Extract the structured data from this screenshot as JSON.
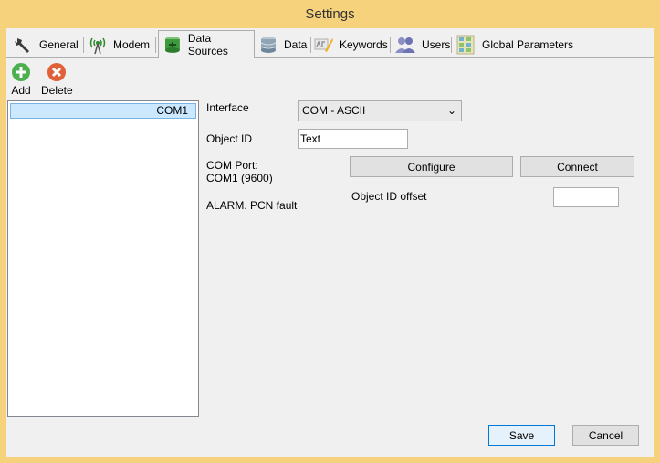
{
  "window": {
    "title": "Settings"
  },
  "tabs": [
    {
      "label": "General",
      "icon": "wrench-icon"
    },
    {
      "label": "Modem",
      "icon": "antenna-icon"
    },
    {
      "label": "Data Sources",
      "icon": "database-plug-icon"
    },
    {
      "label": "Data",
      "icon": "database-icon"
    },
    {
      "label": "Keywords",
      "icon": "keywords-icon"
    },
    {
      "label": "Users",
      "icon": "users-icon"
    },
    {
      "label": "Global Parameters",
      "icon": "grid-icon"
    }
  ],
  "active_tab": "Data Sources",
  "toolbar": {
    "add_label": "Add",
    "delete_label": "Delete"
  },
  "sources_list": {
    "items": [
      "COM1"
    ],
    "selected": "COM1"
  },
  "form": {
    "interface_label": "Interface",
    "interface_value": "COM - ASCII",
    "object_id_label": "Object ID",
    "object_id_value": "Text",
    "com_port_label": "COM Port:",
    "com_port_value": "COM1 (9600)",
    "alarm_text": "ALARM. PCN fault",
    "configure_label": "Configure",
    "connect_label": "Connect",
    "object_id_offset_label": "Object ID offset",
    "object_id_offset_value": ""
  },
  "footer": {
    "save_label": "Save",
    "cancel_label": "Cancel"
  },
  "colors": {
    "title_bar": "#f7d27c",
    "selection": "#cce8ff",
    "default_button_border": "#0078d7"
  }
}
